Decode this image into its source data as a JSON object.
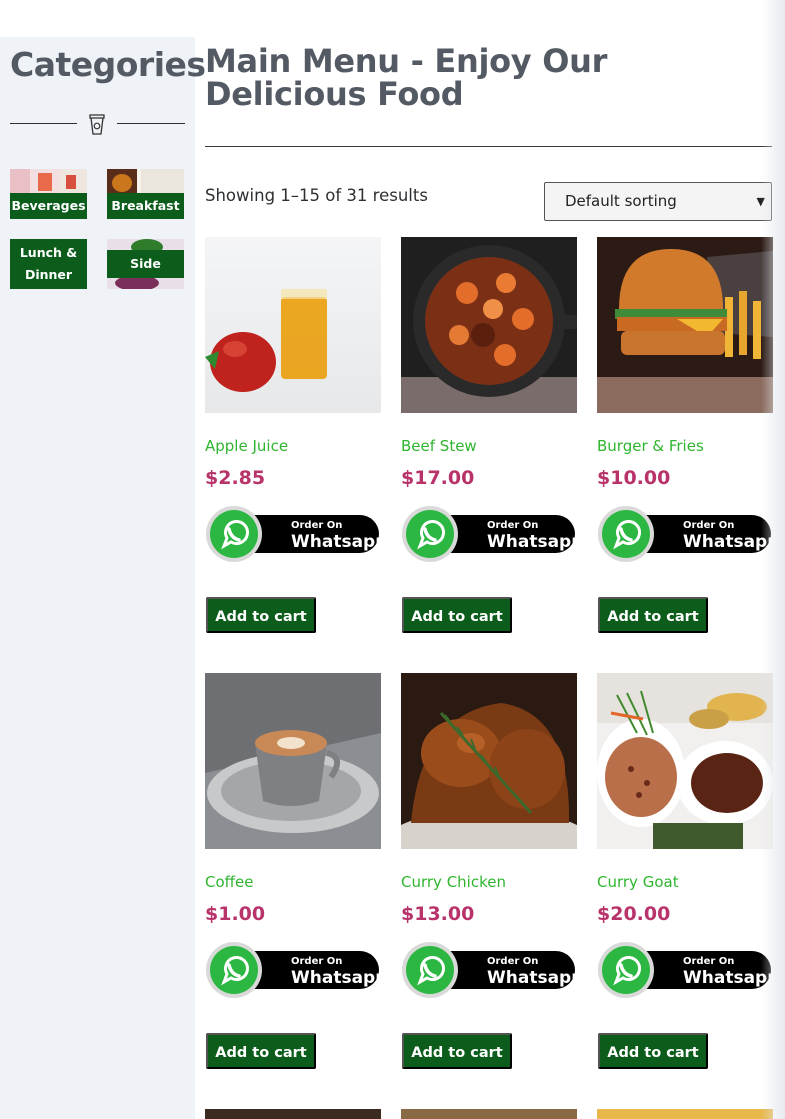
{
  "sidebar": {
    "title": "Categories",
    "divider_icon": "cup-icon",
    "categories": [
      {
        "label": "Beverages"
      },
      {
        "label": "Breakfast"
      },
      {
        "label": "Lunch & Dinner"
      },
      {
        "label": "Side"
      }
    ]
  },
  "main": {
    "title": "Main Menu - Enjoy Our Delicious Food",
    "result_count": "Showing 1–15 of 31 results",
    "sorting": {
      "selected": "Default sorting"
    }
  },
  "whatsapp": {
    "line1": "Order On",
    "line2": "Whatsapp"
  },
  "products": [
    {
      "name": "Apple Juice",
      "price": "$2.85",
      "cart_label": "Add to cart"
    },
    {
      "name": "Beef Stew",
      "price": "$17.00",
      "cart_label": "Add to cart"
    },
    {
      "name": "Burger & Fries",
      "price": "$10.00",
      "cart_label": "Add to cart"
    },
    {
      "name": "Coffee",
      "price": "$1.00",
      "cart_label": "Add to cart"
    },
    {
      "name": "Curry Chicken",
      "price": "$13.00",
      "cart_label": "Add to cart"
    },
    {
      "name": "Curry Goat",
      "price": "$20.00",
      "cart_label": "Add to cart"
    }
  ],
  "colors": {
    "accent_green": "#0c5d1b",
    "product_name": "#2fb52f",
    "price": "#b8336a",
    "heading": "#545a63",
    "sidebar_bg": "#eff2f6"
  }
}
